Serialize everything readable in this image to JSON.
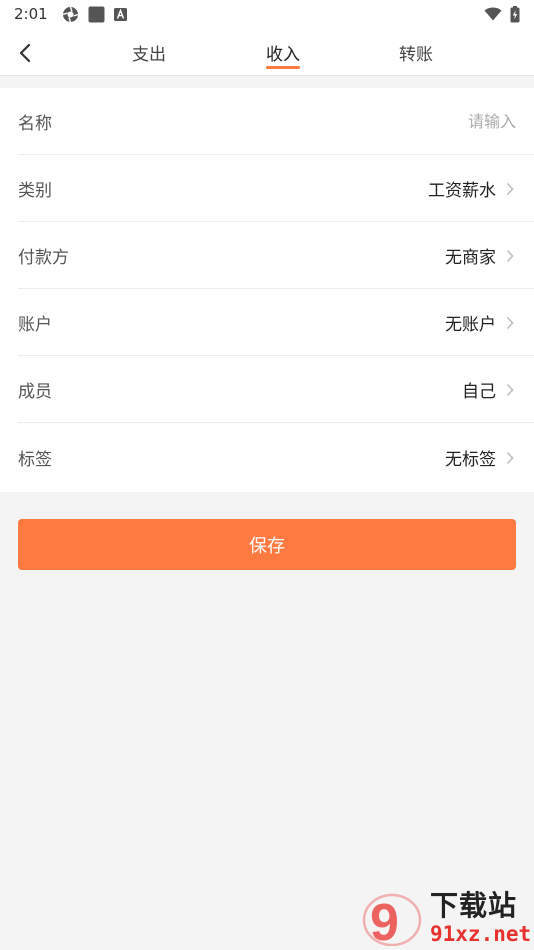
{
  "status_bar": {
    "time": "2:01",
    "icons_left": [
      "shutter-icon",
      "square-app-icon",
      "a-app-icon"
    ],
    "icons_right": [
      "wifi-icon",
      "battery-charging-icon"
    ]
  },
  "header": {
    "back_icon": "back-chevron-icon",
    "tabs": [
      {
        "label": "支出",
        "active": false
      },
      {
        "label": "收入",
        "active": true
      },
      {
        "label": "转账",
        "active": false
      }
    ]
  },
  "form": {
    "name": {
      "label": "名称",
      "value": "",
      "placeholder": "请输入"
    },
    "category": {
      "label": "类别",
      "value": "工资薪水"
    },
    "payer": {
      "label": "付款方",
      "value": "无商家"
    },
    "account": {
      "label": "账户",
      "value": "无账户"
    },
    "member": {
      "label": "成员",
      "value": "自己"
    },
    "tags": {
      "label": "标签",
      "value": "无标签"
    }
  },
  "save_label": "保存",
  "watermark": {
    "brand": "下载站",
    "domain": "91xz.net",
    "badge": "9"
  },
  "colors": {
    "accent": "#ff7a40",
    "watermark_red": "#e8322e"
  }
}
